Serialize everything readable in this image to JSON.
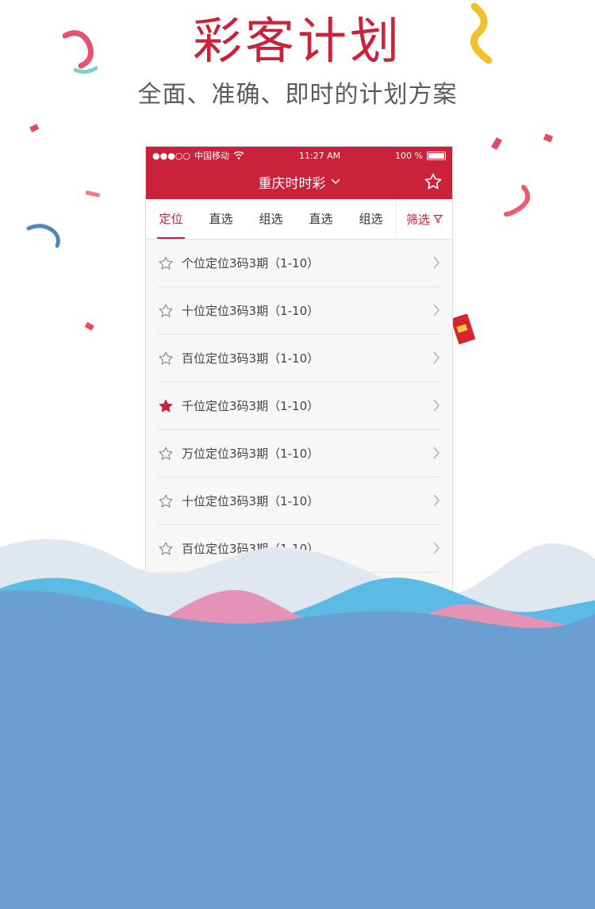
{
  "headline": "彩客计划",
  "subline": "全面、准确、即时的计划方案",
  "colors": {
    "brand": "#c9223a",
    "wave_light": "#dfe8f1",
    "wave_cyan": "#5bbbe4",
    "wave_pink": "#e691b6",
    "wave_blue": "#6b9fd1"
  },
  "phone": {
    "status": {
      "signal": "●●●○○",
      "carrier": "中国移动",
      "time": "11:27 AM",
      "battery": "100 %"
    },
    "nav": {
      "title": "重庆时时彩",
      "dropdown_icon": "chevron-down-icon",
      "fav_icon": "star-outline-icon"
    },
    "tabs": [
      {
        "label": "定位",
        "active": true
      },
      {
        "label": "直选",
        "active": false
      },
      {
        "label": "组选",
        "active": false
      },
      {
        "label": "直选",
        "active": false
      },
      {
        "label": "组选",
        "active": false
      }
    ],
    "filter": {
      "label": "筛选",
      "icon": "filter-icon"
    },
    "rows": [
      {
        "label": "个位定位3码3期（1-10）",
        "starred": false
      },
      {
        "label": "十位定位3码3期（1-10）",
        "starred": false
      },
      {
        "label": "百位定位3码3期（1-10）",
        "starred": false
      },
      {
        "label": "千位定位3码3期（1-10）",
        "starred": true
      },
      {
        "label": "万位定位3码3期（1-10）",
        "starred": false
      },
      {
        "label": "十位定位3码3期（1-10）",
        "starred": false
      },
      {
        "label": "百位定位3码3期（1-10）",
        "starred": false
      },
      {
        "label": "",
        "starred": true
      }
    ]
  }
}
